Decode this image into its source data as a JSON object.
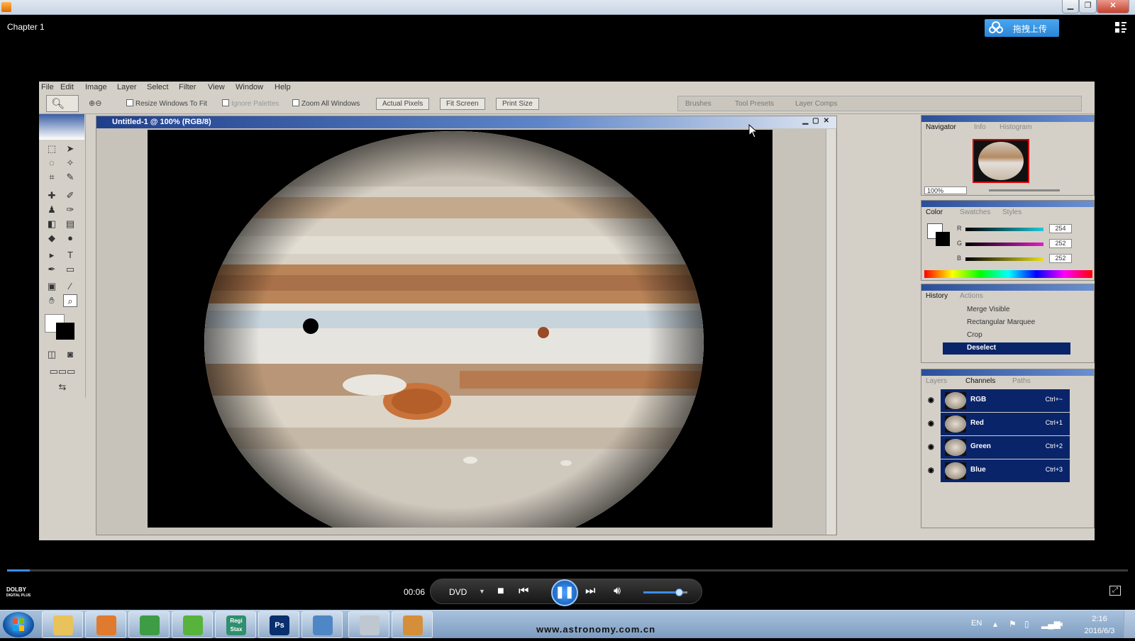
{
  "window": {
    "minimize": "▁",
    "maximize": "❐",
    "close": "✕"
  },
  "player": {
    "chapter": "Chapter 1",
    "upload_label": "拖拽上传",
    "time": "00:06",
    "disc_label": "DVD",
    "progress": 0.02,
    "volume": 0.8,
    "dolby_line1": "DOLBY",
    "dolby_line2": "DIGITAL PLUS"
  },
  "photoshop": {
    "menus": [
      "File",
      "Edit",
      "Image",
      "Layer",
      "Select",
      "Filter",
      "View",
      "Window",
      "Help"
    ],
    "options": {
      "resize_windows": "Resize Windows To Fit",
      "ignore_palettes": "Ignore Palettes",
      "zoom_all": "Zoom All Windows",
      "actual_pixels": "Actual Pixels",
      "fit_screen": "Fit Screen",
      "print_size": "Print Size"
    },
    "palette_well": [
      "Brushes",
      "Tool Presets",
      "Layer Comps"
    ],
    "document_title": "Untitled-1 @ 100% (RGB/8)",
    "navigator": {
      "tabs": [
        "Navigator",
        "Info",
        "Histogram"
      ],
      "zoom": "100%"
    },
    "color": {
      "tabs": [
        "Color",
        "Swatches",
        "Styles"
      ],
      "channels": [
        {
          "label": "R",
          "value": "254",
          "color": "#1ec8d8"
        },
        {
          "label": "G",
          "value": "252",
          "color": "#e01ec8"
        },
        {
          "label": "B",
          "value": "252",
          "color": "#e8e01e"
        }
      ]
    },
    "history": {
      "tabs": [
        "History",
        "Actions"
      ],
      "items": [
        "Merge Visible",
        "Rectangular Marquee",
        "Crop",
        "Deselect"
      ]
    },
    "layers": {
      "tabs": [
        "Layers",
        "Channels",
        "Paths"
      ],
      "channels": [
        {
          "name": "RGB",
          "shortcut": "Ctrl+~"
        },
        {
          "name": "Red",
          "shortcut": "Ctrl+1"
        },
        {
          "name": "Green",
          "shortcut": "Ctrl+2"
        },
        {
          "name": "Blue",
          "shortcut": "Ctrl+3"
        }
      ]
    }
  },
  "taskbar": {
    "apps": [
      {
        "name": "file-explorer",
        "label": "",
        "color": "#e8c25a"
      },
      {
        "name": "media-player",
        "label": "",
        "color": "#e07a2e"
      },
      {
        "name": "chrome",
        "label": "",
        "color": "#3d9c44"
      },
      {
        "name": "utorrent",
        "label": "",
        "color": "#57b33c"
      },
      {
        "name": "registax",
        "label": "Regi Stax",
        "color": "#2f8f6f"
      },
      {
        "name": "photoshop",
        "label": "Ps",
        "color": "#0a2f6e"
      },
      {
        "name": "image-viewer",
        "label": "",
        "color": "#4f86c6"
      },
      {
        "name": "scanner",
        "label": "",
        "color": "#bfc7d0"
      },
      {
        "name": "paint",
        "label": "",
        "color": "#d58f3a"
      }
    ],
    "watermark": "www.astronomy.com.cn",
    "lang": "EN",
    "clock_time": "2:16",
    "clock_date": "2016/6/3"
  }
}
